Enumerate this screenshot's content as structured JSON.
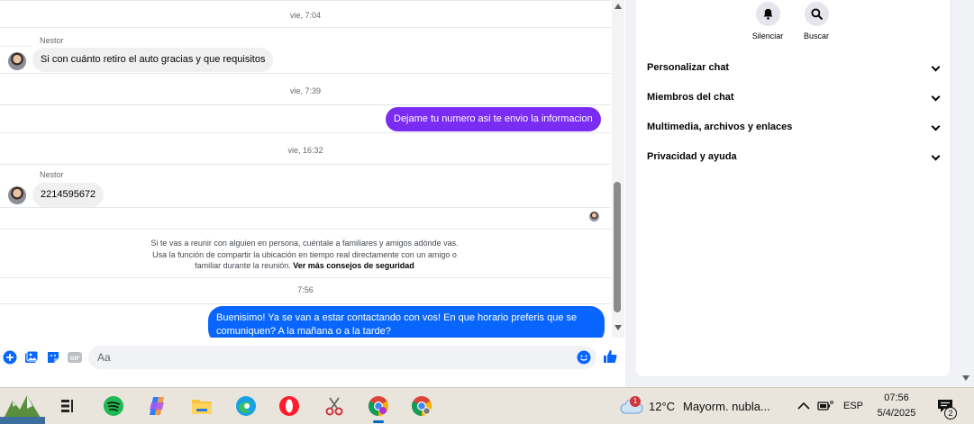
{
  "messages": {
    "ts1": "vie, 7:04",
    "sender1": "Nestor",
    "msg1": "Si con cuánto retiro el auto gracias y que requisitos",
    "ts2": "vie, 7:39",
    "msg2": "Dejame tu numero asi te envio la informacion",
    "ts3": "vie, 16:32",
    "sender2": "Nestor",
    "msg3": "2214595672",
    "notice_text": "Si te vas a reunir con alguien en persona, cuéntale a familiares y amigos adónde vas. Usa la función de compartir la ubicación en tiempo real directamente con un amigo o familiar durante la reunión.",
    "notice_link": "Ver más consejos de seguridad",
    "ts4": "7:56",
    "msg4": "Buenisimo! Ya se van a estar contactando con vos! En que horario preferis que se comuniquen? A la mañana o a la tarde?"
  },
  "composer": {
    "placeholder": "Aa",
    "icons": [
      "plus-icon",
      "image-icon",
      "sticker-icon",
      "gif-icon",
      "emoji-icon",
      "like-icon"
    ],
    "gif_label": "GIF"
  },
  "panel": {
    "silence_label": "Silenciar",
    "search_label": "Buscar",
    "rows": [
      "Personalizar chat",
      "Miembros del chat",
      "Multimedia, archivos y enlaces",
      "Privacidad y ayuda"
    ]
  },
  "taskbar": {
    "apps": [
      "widgets-icon",
      "task-view-icon",
      "spotify-icon",
      "copilot-icon",
      "file-explorer-icon",
      "edge-icon",
      "opera-icon",
      "snipping-tool-icon",
      "chrome-icon",
      "chrome-profile-icon"
    ],
    "weather_badge": "1",
    "temperature": "12°C",
    "weather": "Mayorm. nubla...",
    "language": "ESP",
    "time": "07:56",
    "date": "5/4/2025",
    "notifications": "2"
  },
  "colors": {
    "accent_blue": "#0866ff",
    "accent_purple": "#7b2cf3",
    "incoming_bubble": "#f0f0f0"
  }
}
